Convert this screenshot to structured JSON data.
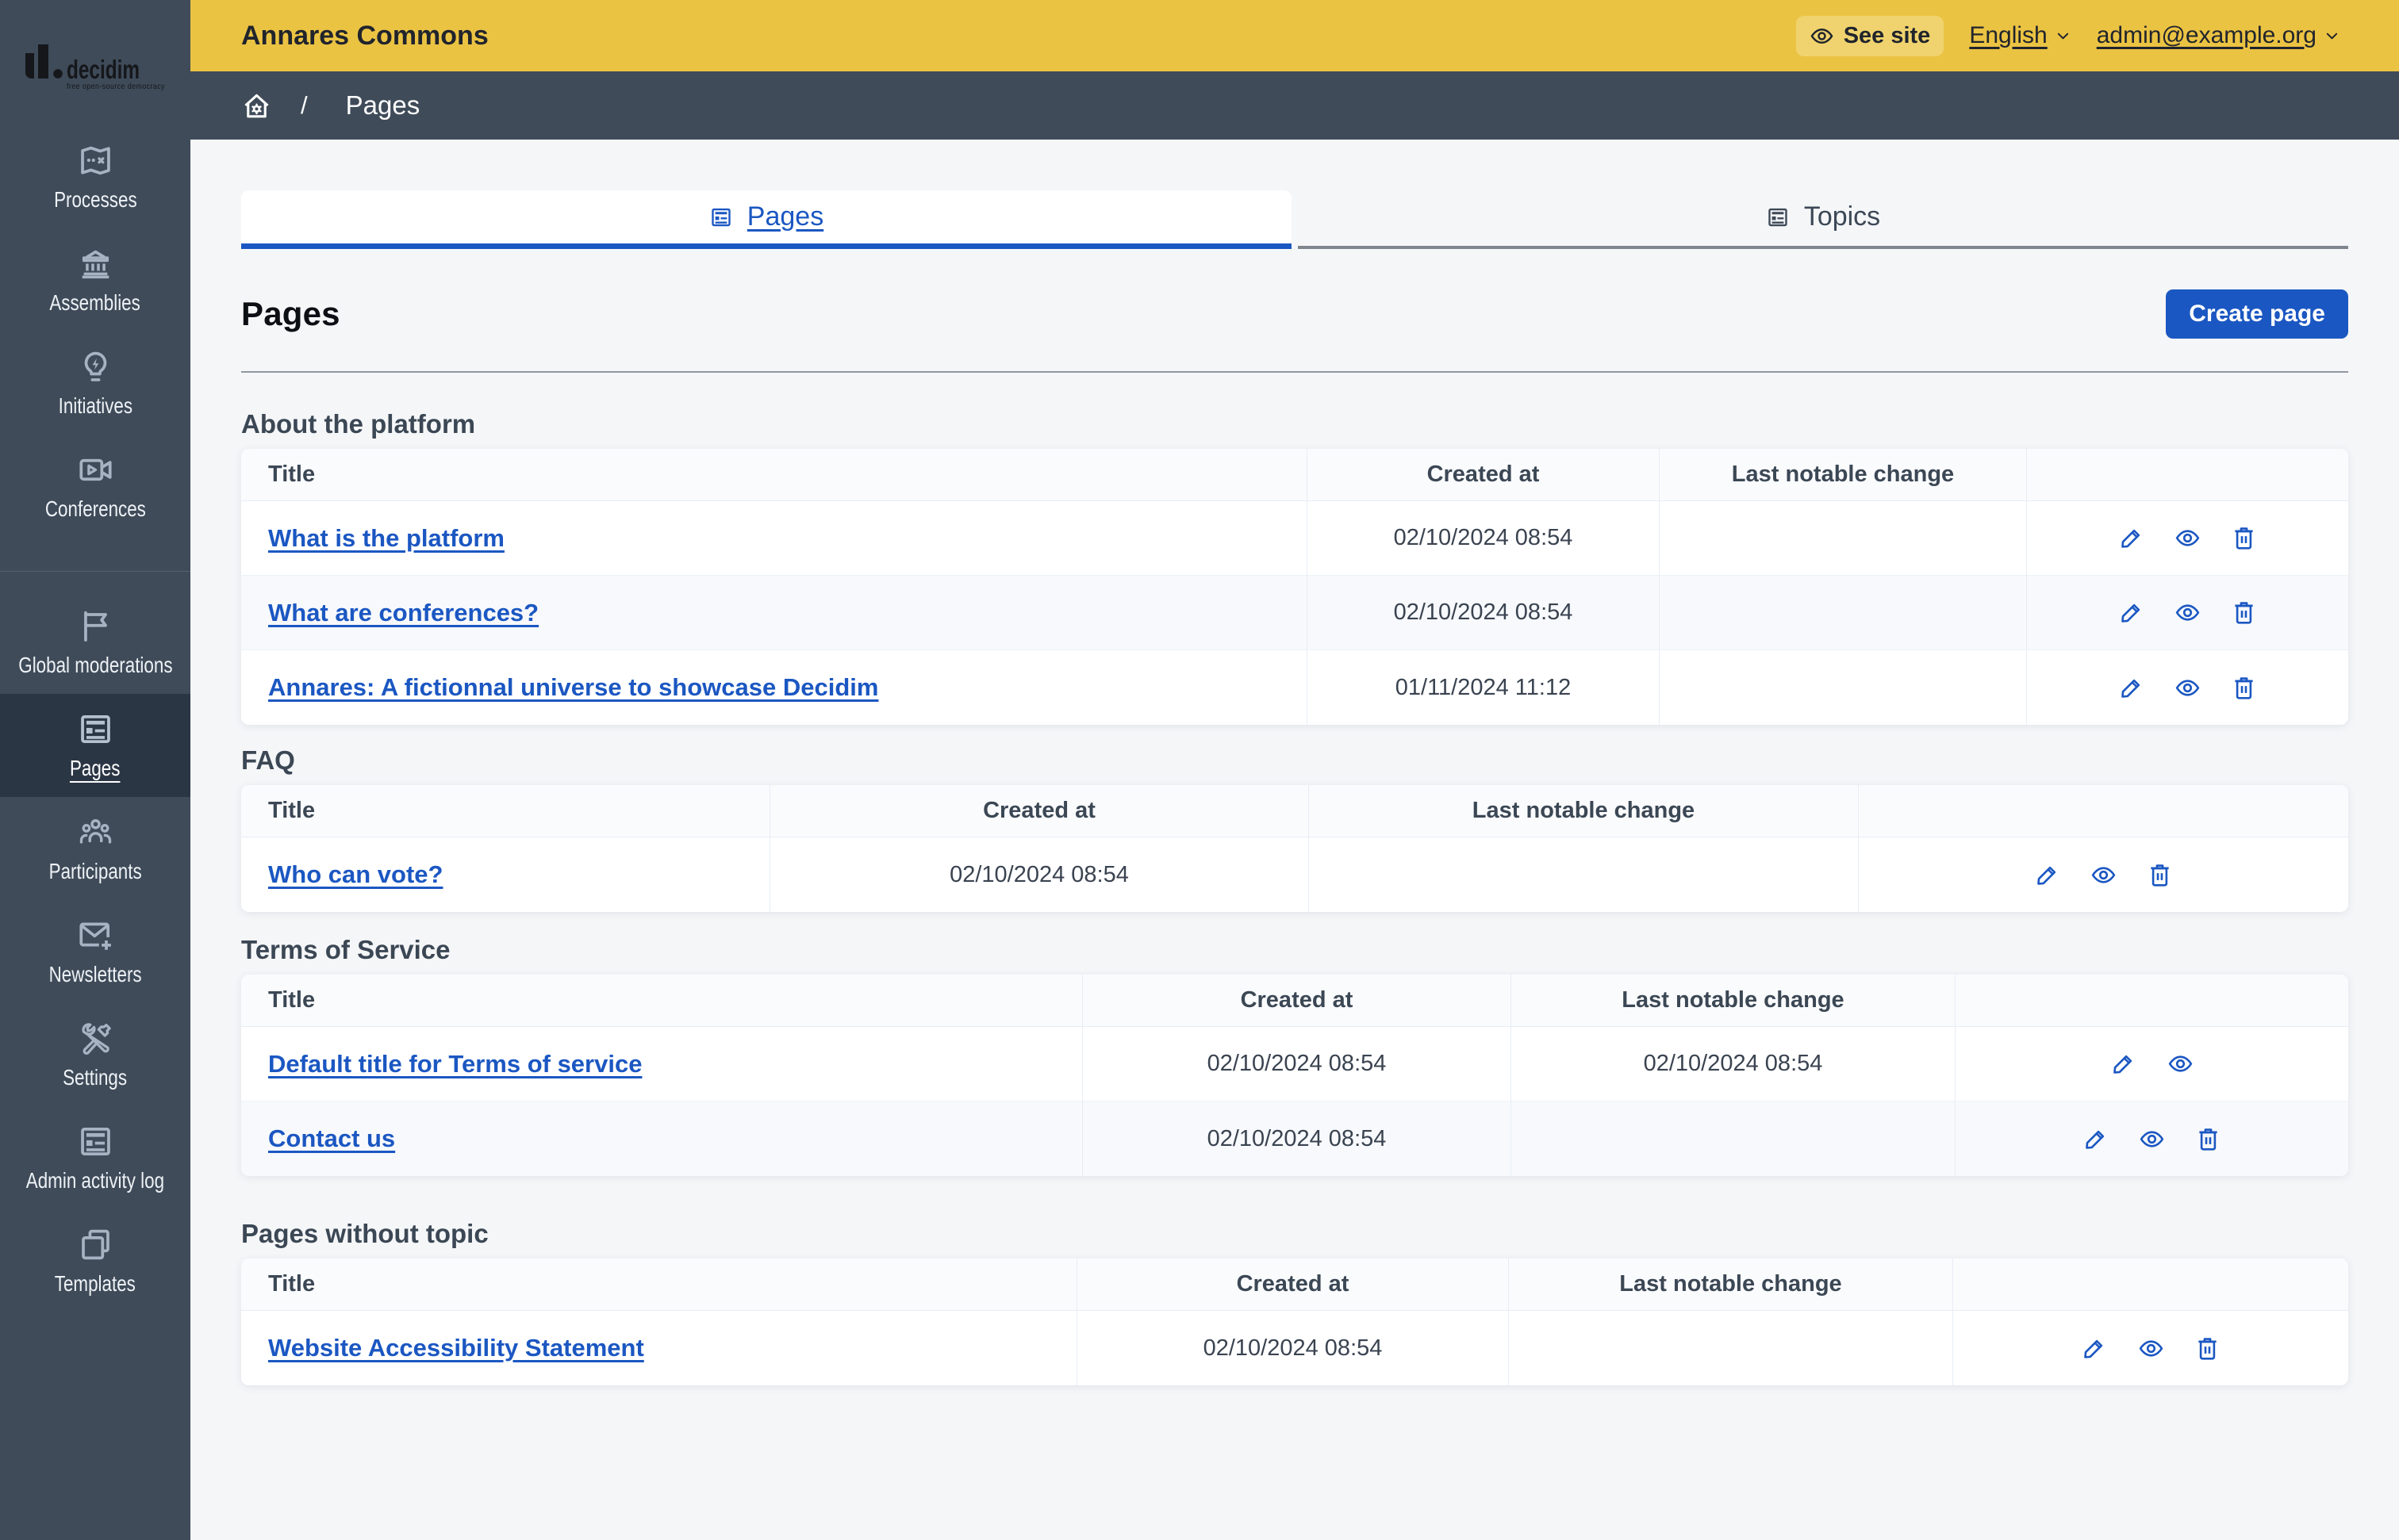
{
  "brand": {
    "wordmark": "decidim",
    "tagline": "free open-source democracy"
  },
  "topbar": {
    "org_name": "Annares Commons",
    "see_site_label": "See site",
    "language_label": "English",
    "user_email": "admin@example.org"
  },
  "breadcrumb": {
    "separator": "/",
    "current": "Pages"
  },
  "sidebar": {
    "main": [
      {
        "label": "Processes",
        "icon": "map-icon"
      },
      {
        "label": "Assemblies",
        "icon": "bank-icon"
      },
      {
        "label": "Initiatives",
        "icon": "lightbulb-flash-icon"
      },
      {
        "label": "Conferences",
        "icon": "video-camera-icon"
      }
    ],
    "admin": [
      {
        "label": "Global moderations",
        "icon": "flag-icon"
      },
      {
        "label": "Pages",
        "icon": "pages-icon",
        "active": true
      },
      {
        "label": "Participants",
        "icon": "team-icon"
      },
      {
        "label": "Newsletters",
        "icon": "mail-add-icon"
      },
      {
        "label": "Settings",
        "icon": "tools-icon"
      },
      {
        "label": "Admin activity log",
        "icon": "article-icon"
      },
      {
        "label": "Templates",
        "icon": "file-copy-icon"
      }
    ]
  },
  "tabs": [
    {
      "label": "Pages",
      "icon": "article-icon",
      "active": true
    },
    {
      "label": "Topics",
      "icon": "article-icon",
      "active": false
    }
  ],
  "page": {
    "title": "Pages",
    "create_button": "Create page"
  },
  "table_headers": {
    "title": "Title",
    "created_at": "Created at",
    "last_change": "Last notable change"
  },
  "sections": [
    {
      "title": "About the platform",
      "rows": [
        {
          "title": "What is the platform",
          "created_at": "02/10/2024 08:54",
          "last_change": "",
          "actions": [
            "edit",
            "preview",
            "delete"
          ]
        },
        {
          "title": "What are conferences?",
          "created_at": "02/10/2024 08:54",
          "last_change": "",
          "actions": [
            "edit",
            "preview",
            "delete"
          ]
        },
        {
          "title": "Annares: A fictionnal universe to showcase Decidim",
          "created_at": "01/11/2024 11:12",
          "last_change": "",
          "actions": [
            "edit",
            "preview",
            "delete"
          ]
        }
      ]
    },
    {
      "title": "FAQ",
      "rows": [
        {
          "title": "Who can vote?",
          "created_at": "02/10/2024 08:54",
          "last_change": "",
          "actions": [
            "edit",
            "preview",
            "delete"
          ]
        }
      ]
    },
    {
      "title": "Terms of Service",
      "rows": [
        {
          "title": "Default title for Terms of service",
          "created_at": "02/10/2024 08:54",
          "last_change": "02/10/2024 08:54",
          "actions": [
            "edit",
            "preview"
          ]
        },
        {
          "title": "Contact us",
          "created_at": "02/10/2024 08:54",
          "last_change": "",
          "actions": [
            "edit",
            "preview",
            "delete"
          ]
        }
      ]
    },
    {
      "title": "Pages without topic",
      "rows": [
        {
          "title": "Website Accessibility Statement",
          "created_at": "02/10/2024 08:54",
          "last_change": "",
          "actions": [
            "edit",
            "preview",
            "delete"
          ]
        }
      ]
    }
  ],
  "colors": {
    "topbar": "#ebc343",
    "sidebar": "#3f4b59",
    "accent_blue": "#1b57c2",
    "page_background": "#f5f6f8"
  }
}
